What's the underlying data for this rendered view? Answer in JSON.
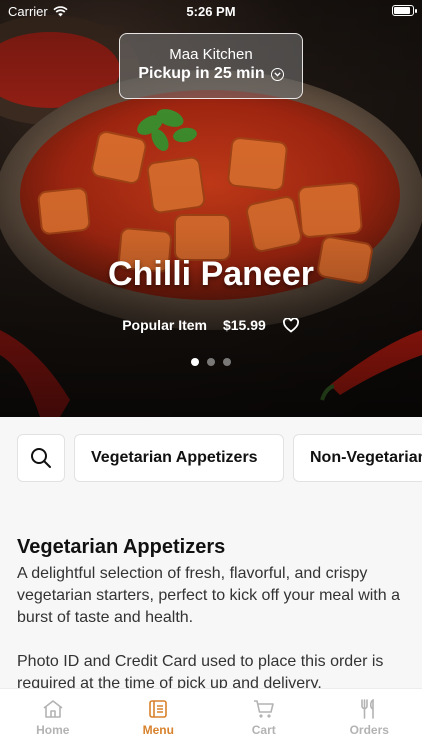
{
  "status_bar": {
    "carrier": "Carrier",
    "time": "5:26 PM",
    "battery_level": 1.0
  },
  "pickup": {
    "restaurant": "Maa Kitchen",
    "eta": "Pickup in 25 min"
  },
  "featured": {
    "title": "Chilli Paneer",
    "tag": "Popular Item",
    "price": "$15.99",
    "slide_count": 3,
    "active_slide": 1
  },
  "categories": [
    "Vegetarian Appetizers",
    "Non-Vegetarian Appetizers"
  ],
  "section": {
    "title": "Vegetarian Appetizers",
    "description": "A delightful selection of fresh, flavorful, and crispy vegetarian starters, perfect to kick off your meal with a burst of taste and health.",
    "note": "Photo ID and Credit Card used to place this order is required at the time of pick up and delivery."
  },
  "tabs": [
    {
      "label": "Home",
      "icon": "home-icon",
      "active": false
    },
    {
      "label": "Menu",
      "icon": "menu-icon",
      "active": true
    },
    {
      "label": "Cart",
      "icon": "cart-icon",
      "active": false
    },
    {
      "label": "Orders",
      "icon": "utensils-icon",
      "active": false
    }
  ],
  "colors": {
    "accent": "#d8822d",
    "tab_inactive": "#b3b3b3"
  }
}
